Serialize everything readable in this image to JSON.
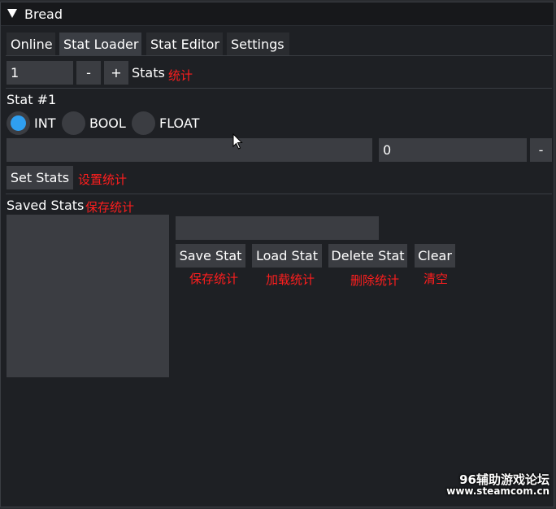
{
  "window": {
    "title": "Bread"
  },
  "tabs": [
    {
      "label": "Online"
    },
    {
      "label": "Stat Loader"
    },
    {
      "label": "Stat Editor"
    },
    {
      "label": "Settings"
    }
  ],
  "stat_loader": {
    "count_value": "1",
    "minus_label": "-",
    "plus_label": "+",
    "stats_label": "Stats",
    "stats_note": "统计",
    "stat_heading": "Stat #1",
    "types": [
      {
        "label": "INT",
        "selected": true
      },
      {
        "label": "BOOL",
        "selected": false
      },
      {
        "label": "FLOAT",
        "selected": false
      }
    ],
    "name_value": "",
    "value_value": "0",
    "value_minus_label": "-",
    "set_stats_label": "Set Stats",
    "set_stats_note": "设置统计"
  },
  "saved_stats": {
    "heading": "Saved Stats",
    "heading_note": "保存统计",
    "name_value": "",
    "buttons": [
      {
        "label": "Save Stat",
        "note": "保存统计"
      },
      {
        "label": "Load Stat",
        "note": "加载统计"
      },
      {
        "label": "Delete Stat",
        "note": "删除统计"
      },
      {
        "label": "Clear",
        "note": "清空"
      }
    ]
  },
  "watermark": {
    "line1": "96辅助游戏论坛",
    "line2": "www.steamcom.cn"
  },
  "colors": {
    "accent": "#2f9ff0",
    "annotation": "#ff1e1e",
    "widget_bg": "#3b3d42",
    "window_bg": "#1e2024"
  }
}
